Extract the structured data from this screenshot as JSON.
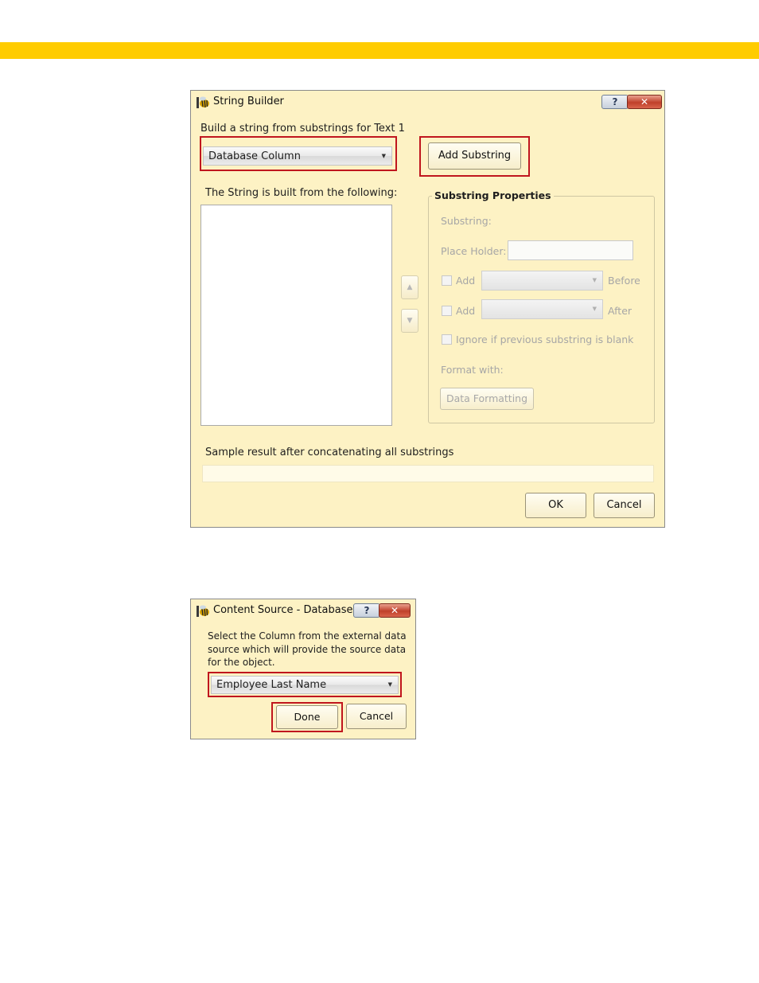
{
  "string_builder": {
    "title": "String Builder",
    "help_label": "?",
    "close_label": "✕",
    "instruction": "Build a string from substrings for Text 1",
    "source_combo_value": "Database Column",
    "add_substring_label": "Add Substring",
    "list_label": "The String is built from the following:",
    "move_up_glyph": "▲",
    "move_down_glyph": "▼",
    "properties": {
      "title": "Substring Properties",
      "substring_label": "Substring:",
      "placeholder_label": "Place Holder:",
      "add_before_label": "Add",
      "before_label": "Before",
      "add_after_label": "Add",
      "after_label": "After",
      "ignore_label": "Ignore if previous substring is blank",
      "format_label": "Format with:",
      "data_formatting_label": "Data Formatting"
    },
    "sample_label": "Sample result after concatenating all substrings",
    "ok_label": "OK",
    "cancel_label": "Cancel"
  },
  "content_source": {
    "title": "Content Source - Database",
    "help_label": "?",
    "close_label": "✕",
    "instruction_lines": [
      "Select the Column from the external data",
      "source which will provide the source data",
      "for the object."
    ],
    "column_combo_value": "Employee Last Name",
    "done_label": "Done",
    "cancel_label": "Cancel"
  },
  "colors": {
    "top_band": "#ffcc00",
    "dialog_background": "#fdf2c4",
    "highlight_box": "#c0161e"
  },
  "icons": [
    "app-bee-icon",
    "help-icon",
    "close-icon",
    "dropdown-arrow-icon",
    "move-up-icon",
    "move-down-icon"
  ]
}
